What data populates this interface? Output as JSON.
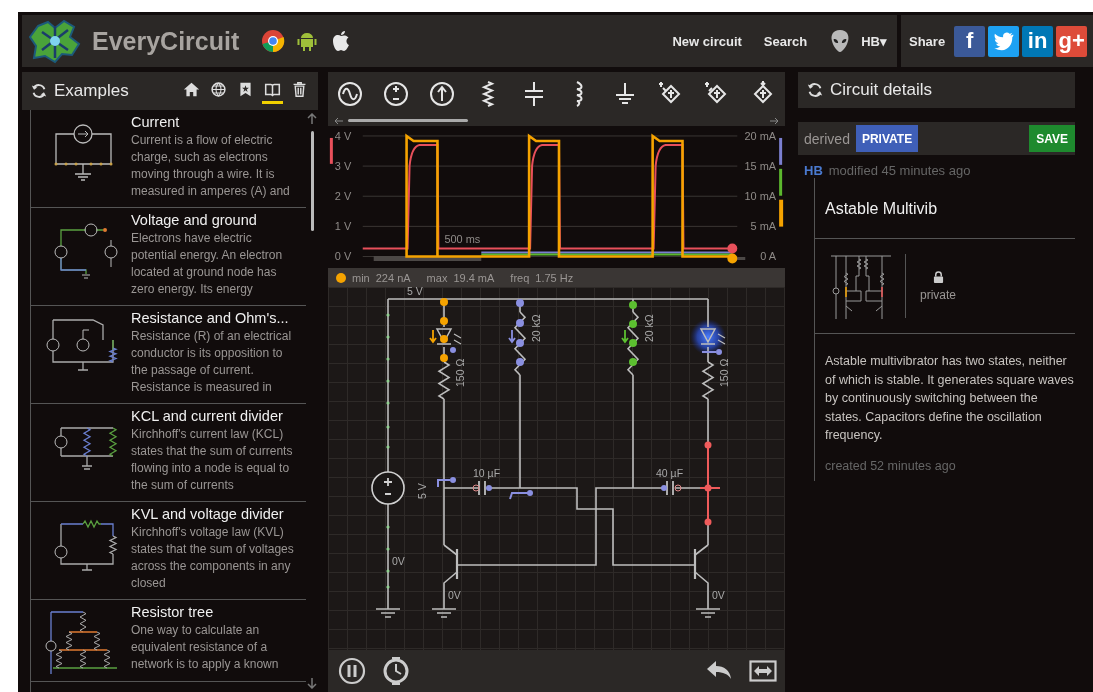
{
  "header": {
    "brand": "EveryCircuit",
    "platforms": [
      {
        "kind": "chrome"
      },
      {
        "kind": "android"
      },
      {
        "kind": "apple"
      }
    ],
    "nav": [
      "New circuit",
      "Search"
    ],
    "user": "HB",
    "user_caret": "▾",
    "share_label": "Share",
    "share_buttons": [
      {
        "kind": "facebook",
        "label": "f"
      },
      {
        "kind": "twitter"
      },
      {
        "kind": "linkedin",
        "label": "in"
      },
      {
        "kind": "google",
        "label": "g+"
      }
    ]
  },
  "examples": {
    "title": "Examples",
    "tabs": [
      {
        "kind": "home",
        "selected": false
      },
      {
        "kind": "globe",
        "selected": false
      },
      {
        "kind": "bookmark",
        "selected": false
      },
      {
        "kind": "book",
        "selected": true
      },
      {
        "kind": "trash",
        "selected": false
      }
    ],
    "items": [
      {
        "kind": "current",
        "title": "Current",
        "description": "Current is a flow of electric charge, such as electrons moving through a wire. It is measured in amperes (A) and"
      },
      {
        "kind": "voltage",
        "title": "Voltage and ground",
        "description": "Electrons have electric potential energy. An electron located at ground node has zero energy. Its energy"
      },
      {
        "kind": "ohm",
        "title": "Resistance and Ohm's...",
        "description": "Resistance (R) of an electrical conductor is its opposition to the passage of current. Resistance is measured in"
      },
      {
        "kind": "kcl",
        "title": "KCL and current divider",
        "description": "Kirchhoff's current law (KCL) states that the sum of currents flowing into a node is equal to the sum of currents"
      },
      {
        "kind": "kvl",
        "title": "KVL and voltage divider",
        "description": "Kirchhoff's voltage law (KVL) states that the sum of voltages across the components in any closed"
      },
      {
        "kind": "tree",
        "title": "Resistor tree",
        "description": "One way to calculate an equivalent resistance of a network is to apply a known"
      }
    ]
  },
  "toolbar": {
    "components": [
      {
        "kind": "ac-source"
      },
      {
        "kind": "voltage-source"
      },
      {
        "kind": "current-source"
      },
      {
        "kind": "resistor"
      },
      {
        "kind": "capacitor"
      },
      {
        "kind": "inductor"
      },
      {
        "kind": "ground"
      },
      {
        "kind": "npn"
      },
      {
        "kind": "pnp"
      },
      {
        "kind": "diode-block"
      }
    ]
  },
  "scope": {
    "left_ticks": [
      "4 V",
      "3 V",
      "2 V",
      "1 V",
      "0 V"
    ],
    "right_ticks": [
      "20 mA",
      "15 mA",
      "10 mA",
      "5 mA",
      "0 A"
    ],
    "time_scale": "500 ms",
    "traces": [
      {
        "kind": "voltage",
        "pulsed": true,
        "color": "#e8505b",
        "selected": false
      },
      {
        "kind": "current",
        "pulsed": false,
        "color": "#7b7fd0",
        "selected": false
      },
      {
        "kind": "current",
        "pulsed": false,
        "color": "#5cb82e",
        "selected": false
      },
      {
        "kind": "current",
        "pulsed": true,
        "color": "#f5a300",
        "selected": true
      }
    ],
    "stats": [
      {
        "label": "min",
        "value": "224 nA"
      },
      {
        "label": "max",
        "value": "19.4 mA"
      },
      {
        "label": "freq",
        "value": "1.75 Hz"
      }
    ]
  },
  "circuit": {
    "labels": [
      "5 V",
      "20 kΩ",
      "20 kΩ",
      "150 Ω",
      "150 Ω",
      "10 µF",
      "40 µF",
      "5 V",
      "0V",
      "0V",
      "0V"
    ]
  },
  "controls": [
    {
      "kind": "pause"
    },
    {
      "kind": "clock"
    },
    {
      "kind": "undo"
    },
    {
      "kind": "fit"
    }
  ],
  "details": {
    "title": "Circuit details",
    "derived": "derived",
    "visibility_button": "PRIVATE",
    "save_button": "SAVE",
    "author": "HB",
    "modified": "modified 45 minutes ago",
    "name": "Astable Multivib",
    "lock_label": "private",
    "description": "Astable multivibrator has two states, neither of which is stable. It generates square waves by continuously switching between the states. Capacitors define the oscillation frequency.",
    "created": "created 52 minutes ago"
  }
}
